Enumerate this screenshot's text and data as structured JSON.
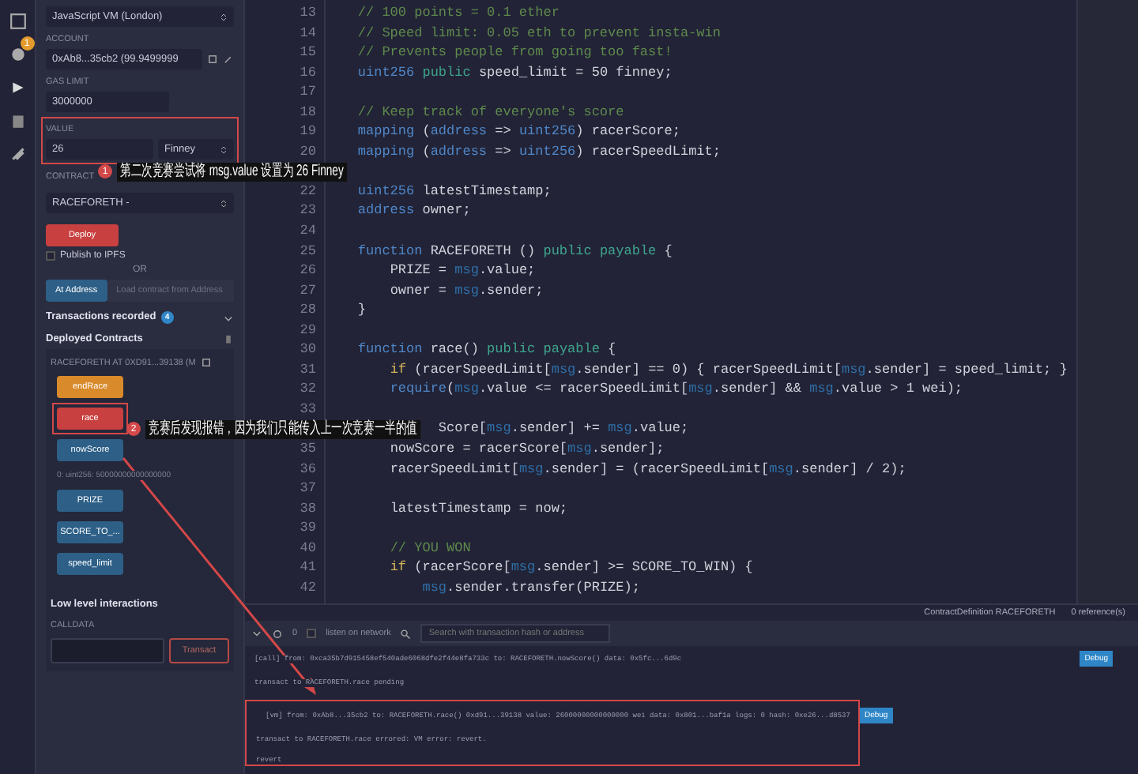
{
  "rail": {
    "badge": "1"
  },
  "run_panel": {
    "environment": "JavaScript VM (London)",
    "account_label": "ACCOUNT",
    "account": "0xAb8...35cb2 (99.9499999",
    "gas_label": "GAS LIMIT",
    "gas": "3000000",
    "value_label": "VALUE",
    "value": "26",
    "unit": "Finney",
    "contract_label": "CONTRACT",
    "contract": "RACEFORETH - ",
    "deploy": "Deploy",
    "publish": {
      "label": "Publish to IPFS",
      "checked": false
    },
    "or": "OR",
    "at_address": "At Address",
    "load_contract": "Load contract from Address",
    "transactions_recorded": "Transactions recorded",
    "transactions_count": "4",
    "deployed_contracts": "Deployed Contracts",
    "instance": "RACEFORETH AT 0XD91...39138 (M",
    "functions": [
      {
        "name": "endRace",
        "kind": "transact"
      },
      {
        "name": "race",
        "kind": "payable"
      },
      {
        "name": "nowScore",
        "kind": "call",
        "result": "0: uint256: 50000000000000000"
      },
      {
        "name": "PRIZE",
        "kind": "call"
      },
      {
        "name": "SCORE_TO_...",
        "kind": "call"
      },
      {
        "name": "speed_limit",
        "kind": "call"
      }
    ],
    "low_level": "Low level interactions",
    "calldata_label": "CALLDATA",
    "transact": "Transact"
  },
  "editor": {
    "lines": [
      {
        "number": "13",
        "tokens": [
          {
            "text": "    // 100 points = 0.1 ether",
            "kind": "comment"
          }
        ]
      },
      {
        "number": "14",
        "tokens": [
          {
            "text": "    // Speed limit: 0.05 eth to prevent insta-win",
            "kind": "comment"
          }
        ]
      },
      {
        "number": "15",
        "tokens": [
          {
            "text": "    // Prevents people from going too fast!",
            "kind": "comment"
          }
        ]
      },
      {
        "number": "16",
        "tokens": [
          {
            "text": "    uint256",
            "kind": "type"
          },
          {
            "text": " public",
            "kind": "modifier"
          },
          {
            "text": " speed_limit = 50 finney;",
            "kind": "plain"
          }
        ]
      },
      {
        "number": "17"
      },
      {
        "number": "18",
        "tokens": [
          {
            "text": "    // Keep track of everyone's score",
            "kind": "comment"
          }
        ]
      },
      {
        "number": "19",
        "tokens": [
          {
            "text": "    mapping",
            "kind": "type"
          },
          {
            "text": " (",
            "kind": "plain"
          },
          {
            "text": "address",
            "kind": "type"
          },
          {
            "text": " => ",
            "kind": "plain"
          },
          {
            "text": "uint256",
            "kind": "type"
          },
          {
            "text": ") racerScore;",
            "kind": "plain"
          }
        ]
      },
      {
        "number": "20",
        "tokens": [
          {
            "text": "    mapping",
            "kind": "type"
          },
          {
            "text": " (",
            "kind": "plain"
          },
          {
            "text": "address",
            "kind": "type"
          },
          {
            "text": " => ",
            "kind": "plain"
          },
          {
            "text": "uint256",
            "kind": "type"
          },
          {
            "text": ") racerSpeedLimit;",
            "kind": "plain"
          }
        ]
      },
      {
        "covered": true
      },
      {
        "number": "22",
        "tokens": [
          {
            "text": "    uint256",
            "kind": "type"
          },
          {
            "text": " latestTimestamp;",
            "kind": "plain"
          }
        ]
      },
      {
        "number": "23",
        "tokens": [
          {
            "text": "    address",
            "kind": "type"
          },
          {
            "text": " owner;",
            "kind": "plain"
          }
        ]
      },
      {
        "number": "24"
      },
      {
        "number": "25",
        "tokens": [
          {
            "text": "    function",
            "kind": "type"
          },
          {
            "text": " RACEFORETH () ",
            "kind": "plain"
          },
          {
            "text": "public payable",
            "kind": "modifier"
          },
          {
            "text": " {",
            "kind": "plain"
          }
        ]
      },
      {
        "number": "26",
        "tokens": [
          {
            "text": "        PRIZE = ",
            "kind": "plain"
          },
          {
            "text": "msg",
            "kind": "global"
          },
          {
            "text": ".value;",
            "kind": "plain"
          }
        ]
      },
      {
        "number": "27",
        "tokens": [
          {
            "text": "        owner = ",
            "kind": "plain"
          },
          {
            "text": "msg",
            "kind": "global"
          },
          {
            "text": ".sender;",
            "kind": "plain"
          }
        ]
      },
      {
        "number": "28",
        "tokens": [
          {
            "text": "    }",
            "kind": "plain"
          }
        ]
      },
      {
        "number": "29"
      },
      {
        "number": "30",
        "tokens": [
          {
            "text": "    function",
            "kind": "type"
          },
          {
            "text": " race() ",
            "kind": "plain"
          },
          {
            "text": "public payable",
            "kind": "modifier"
          },
          {
            "text": " {",
            "kind": "plain"
          }
        ]
      },
      {
        "number": "31",
        "tokens": [
          {
            "text": "        if",
            "kind": "control"
          },
          {
            "text": " (racerSpeedLimit[",
            "kind": "plain"
          },
          {
            "text": "msg",
            "kind": "global"
          },
          {
            "text": ".sender] == 0) { racerSpeedLimit[",
            "kind": "plain"
          },
          {
            "text": "msg",
            "kind": "global"
          },
          {
            "text": ".sender] = speed_limit; }",
            "kind": "plain"
          }
        ]
      },
      {
        "number": "32",
        "tokens": [
          {
            "text": "        require",
            "kind": "type"
          },
          {
            "text": "(",
            "kind": "plain"
          },
          {
            "text": "msg",
            "kind": "global"
          },
          {
            "text": ".value <= racerSpeedLimit[",
            "kind": "plain"
          },
          {
            "text": "msg",
            "kind": "global"
          },
          {
            "text": ".sender] && ",
            "kind": "plain"
          },
          {
            "text": "msg",
            "kind": "global"
          },
          {
            "text": ".value > 1 wei);",
            "kind": "plain"
          }
        ]
      },
      {
        "number": "33"
      },
      {
        "tokens": [
          {
            "text": "              Score[",
            "kind": "plain"
          },
          {
            "text": "msg",
            "kind": "global"
          },
          {
            "text": ".sender] += ",
            "kind": "plain"
          },
          {
            "text": "msg",
            "kind": "global"
          },
          {
            "text": ".value;",
            "kind": "plain"
          }
        ]
      },
      {
        "number": "35",
        "tokens": [
          {
            "text": "        nowScore = racerScore[",
            "kind": "plain"
          },
          {
            "text": "msg",
            "kind": "global"
          },
          {
            "text": ".sender];",
            "kind": "plain"
          }
        ]
      },
      {
        "number": "36",
        "tokens": [
          {
            "text": "        racerSpeedLimit[",
            "kind": "plain"
          },
          {
            "text": "msg",
            "kind": "global"
          },
          {
            "text": ".sender] = (racerSpeedLimit[",
            "kind": "plain"
          },
          {
            "text": "msg",
            "kind": "global"
          },
          {
            "text": ".sender] / 2);",
            "kind": "plain"
          }
        ]
      },
      {
        "number": "37"
      },
      {
        "number": "38",
        "tokens": [
          {
            "text": "        latestTimestamp = now;",
            "kind": "plain"
          }
        ]
      },
      {
        "number": "39"
      },
      {
        "number": "40",
        "tokens": [
          {
            "text": "        // YOU WON",
            "kind": "comment"
          }
        ]
      },
      {
        "number": "41",
        "tokens": [
          {
            "text": "        if",
            "kind": "control"
          },
          {
            "text": " (racerScore[",
            "kind": "plain"
          },
          {
            "text": "msg",
            "kind": "global"
          },
          {
            "text": ".sender] >= SCORE_TO_WIN) {",
            "kind": "plain"
          }
        ]
      },
      {
        "number": "42",
        "tokens": [
          {
            "text": "            msg",
            "kind": "global"
          },
          {
            "text": ".sender.transfer(PRIZE);",
            "kind": "plain"
          }
        ]
      }
    ]
  },
  "terminal": {
    "definition": "ContractDefinition RACEFORETH",
    "references": "0 reference(s)",
    "pending_count": "0",
    "listen": {
      "label": "listen on network",
      "checked": false
    },
    "search": {
      "placeholder": "Search with transaction hash or address"
    },
    "log": [
      {
        "kind": "call",
        "text": "[call] from: 0xca35b7d915458ef540ade6068dfe2f44e8fa733c to: RACEFORETH.nowScore() data: 0x5fc...6d9c",
        "debug": "Debug"
      },
      {
        "kind": "info",
        "text": "transact to RACEFORETH.race pending"
      },
      {
        "kind": "error",
        "text": "[vm] from: 0xAb8...35cb2 to: RACEFORETH.race() 0xd91...39138 value: 26000000000000000 wei data: 0x801...baf1a logs: 0 hash: 0xe26...d8537",
        "debug": "Debug"
      },
      {
        "kind": "info",
        "text": "transact to RACEFORETH.race errored: VM error: revert."
      },
      {
        "kind": "info",
        "text": "revert"
      }
    ]
  },
  "annotations": [
    {
      "number": "1",
      "text": "第二次竞赛尝试将 msg.value 设置为 26 Finney"
    },
    {
      "number": "2",
      "text": "竞赛后发现报错，因为我们只能传入上一次竞赛一半的值"
    }
  ]
}
